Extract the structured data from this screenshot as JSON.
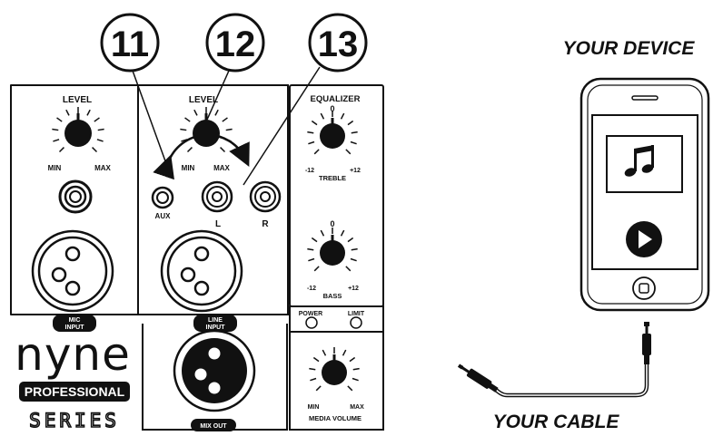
{
  "callouts": [
    "11",
    "12",
    "13"
  ],
  "mic_section": {
    "level_label": "LEVEL",
    "min_label": "MIN",
    "max_label": "MAX",
    "input_label": [
      "MIC",
      "INPUT"
    ]
  },
  "line_section": {
    "level_label": "LEVEL",
    "min_label": "MIN",
    "max_label": "MAX",
    "aux_label": "AUX",
    "left_label": "L",
    "right_label": "R",
    "input_label": [
      "LINE",
      "INPUT"
    ]
  },
  "equalizer": {
    "title": "EQUALIZER",
    "treble": {
      "zero": "0",
      "neg": "-12",
      "pos": "+12",
      "label": "TREBLE"
    },
    "bass": {
      "zero": "0",
      "neg": "-12",
      "pos": "+12",
      "label": "BASS"
    }
  },
  "indicators": {
    "power": "POWER",
    "limit": "LIMIT"
  },
  "media_volume": {
    "min": "MIN",
    "max": "MAX",
    "label": "MEDIA VOLUME"
  },
  "mix_out_label": "MIX OUT",
  "brand": {
    "name": "nyne",
    "tier": "PROFESSIONAL",
    "series": "SERIES"
  },
  "device_label": "YOUR DEVICE",
  "cable_label": "YOUR CABLE",
  "icons": [
    "music-note-icon",
    "play-icon"
  ]
}
